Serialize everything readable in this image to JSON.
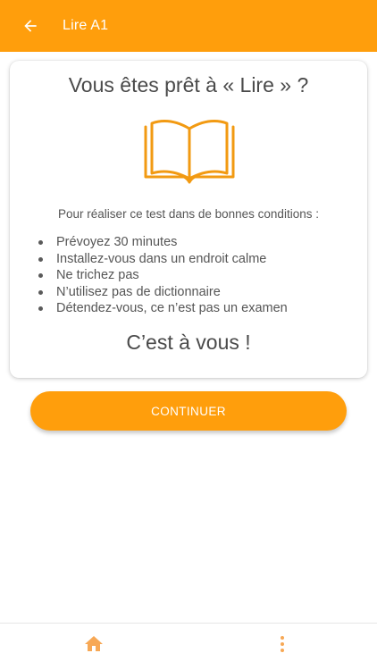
{
  "header": {
    "title": "Lire A1",
    "back_icon": "arrow-left-icon",
    "background_color": "#FF9E0C"
  },
  "card": {
    "title": "Vous êtes prêt à « Lire » ?",
    "illustration_icon": "open-book-icon",
    "intro": "Pour réaliser ce test dans de bonnes conditions :",
    "conditions": [
      "Prévoyez 30 minutes",
      "Installez-vous dans un endroit calme",
      "Ne trichez pas",
      "N’utilisez pas de dictionnaire",
      "Détendez-vous, ce n’est pas un examen"
    ],
    "outro": "C’est à vous !"
  },
  "actions": {
    "continue_label": "CONTINUER",
    "accent_color": "#FF9E0C"
  },
  "bottom_nav": {
    "home_icon": "home-icon",
    "more_icon": "more-vertical-icon"
  }
}
